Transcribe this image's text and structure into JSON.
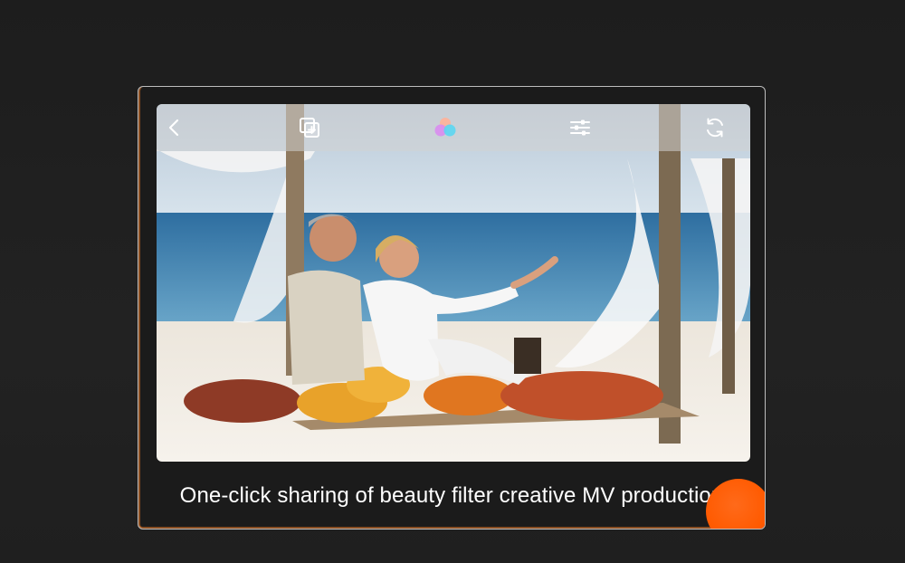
{
  "toolbar": {
    "icons": [
      "back-icon",
      "add-clip-icon",
      "filter-icon",
      "adjust-sliders-icon",
      "refresh-icon"
    ]
  },
  "caption": "One-click sharing of beauty filter creative MV production",
  "colors": {
    "background": "#1f1f1f",
    "frame_border": "#bdbdbd",
    "accent": "#ff5a00",
    "toolbar_overlay": "rgba(210,210,210,0.55)"
  }
}
